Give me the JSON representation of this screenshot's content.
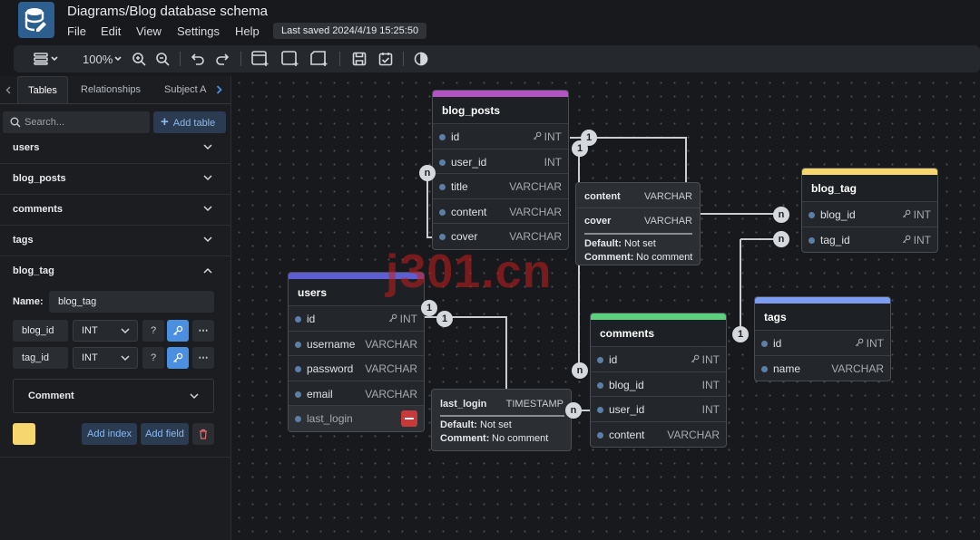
{
  "app": {
    "title": "Diagrams/Blog database schema",
    "menu": [
      "File",
      "Edit",
      "View",
      "Settings",
      "Help"
    ],
    "last_saved": "Last saved 2024/4/19 15:25:50"
  },
  "toolbar": {
    "zoom": "100%",
    "icons": [
      "layout-icon",
      "zoom-in-icon",
      "zoom-out-icon",
      "undo-icon",
      "redo-icon",
      "add-table-icon",
      "add-area-icon",
      "add-note-icon",
      "save-icon",
      "todo-icon",
      "theme-icon"
    ]
  },
  "sidebar": {
    "tabs": [
      "Tables",
      "Relationships",
      "Subject A"
    ],
    "search_placeholder": "Search...",
    "add_table_label": "Add table",
    "tables": [
      "users",
      "blog_posts",
      "comments",
      "tags",
      "blog_tag"
    ],
    "expanded": {
      "name_label": "Name:",
      "name_value": "blog_tag",
      "fields": [
        {
          "name": "blog_id",
          "type": "INT",
          "null_label": "?"
        },
        {
          "name": "tag_id",
          "type": "INT",
          "null_label": "?"
        }
      ],
      "comment_label": "Comment",
      "add_index_label": "Add index",
      "add_field_label": "Add field",
      "color": "#f6d76e"
    }
  },
  "canvas": {
    "tables": {
      "blog_posts": {
        "name": "blog_posts",
        "color": "#b155c2",
        "fields": [
          [
            "id",
            "INT"
          ],
          [
            "user_id",
            "INT"
          ],
          [
            "title",
            "VARCHAR"
          ],
          [
            "content",
            "VARCHAR"
          ],
          [
            "cover",
            "VARCHAR"
          ]
        ]
      },
      "users": {
        "name": "users",
        "color": "#5d5ed1",
        "fields": [
          [
            "id",
            "INT"
          ],
          [
            "username",
            "VARCHAR"
          ],
          [
            "password",
            "VARCHAR"
          ],
          [
            "email",
            "VARCHAR"
          ],
          [
            "last_login",
            ""
          ]
        ]
      },
      "comments": {
        "name": "comments",
        "color": "#5ad17a",
        "fields": [
          [
            "id",
            "INT"
          ],
          [
            "blog_id",
            "INT"
          ],
          [
            "user_id",
            "INT"
          ],
          [
            "content",
            "VARCHAR"
          ]
        ]
      },
      "blog_tag": {
        "name": "blog_tag",
        "color": "#f6d76e",
        "fields": [
          [
            "blog_id",
            "INT"
          ],
          [
            "tag_id",
            "INT"
          ]
        ]
      },
      "tags": {
        "name": "tags",
        "color": "#7d9ef0",
        "fields": [
          [
            "id",
            "INT"
          ],
          [
            "name",
            "VARCHAR"
          ]
        ]
      }
    },
    "popup_cover": {
      "content_name": "content",
      "content_type": "VARCHAR",
      "cover_name": "cover",
      "cover_type": "VARCHAR",
      "default_label": "Default:",
      "default_value": "Not set",
      "comment_label": "Comment:",
      "comment_value": "No comment"
    },
    "popup_last_login": {
      "name": "last_login",
      "type": "TIMESTAMP",
      "default_label": "Default:",
      "default_value": "Not set",
      "comment_label": "Comment:",
      "comment_value": "No comment"
    },
    "cardinality": {
      "one": "1",
      "many": "n"
    },
    "watermark": "j301.cn"
  }
}
